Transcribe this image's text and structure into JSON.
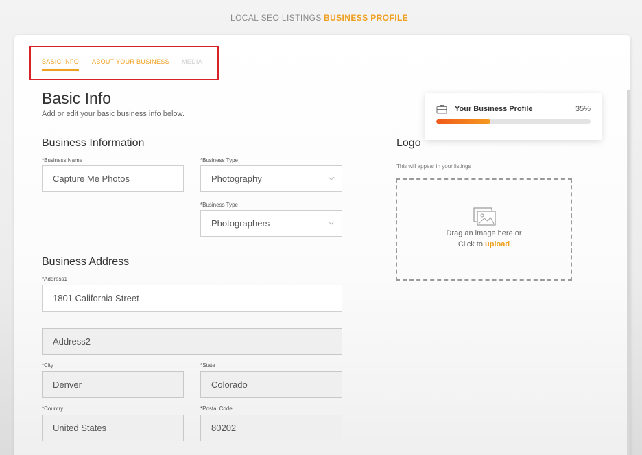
{
  "top_nav": {
    "local_seo": "LOCAL SEO LISTINGS",
    "business_profile": "BUSINESS PROFILE"
  },
  "sub_tabs": {
    "basic_info": "BASIC INFO",
    "about": "ABOUT YOUR BUSINESS",
    "media": "MEDIA"
  },
  "header": {
    "title": "Basic Info",
    "subtitle": "Add or edit your basic business info below."
  },
  "business_info": {
    "title": "Business Information",
    "name_label": "*Business Name",
    "name_value": "Capture Me Photos",
    "type_label": "*Business Type",
    "type_value": "Photography",
    "type2_label": "*Business Type",
    "type2_value": "Photographers"
  },
  "address": {
    "title": "Business Address",
    "address1_label": "*Address1",
    "address1_value": "1801 California Street",
    "address2_placeholder": "Address2",
    "city_label": "*City",
    "city_value": "Denver",
    "state_label": "*State",
    "state_value": "Colorado",
    "country_label": "*Country",
    "country_value": "United States",
    "postal_label": "*Postal Code",
    "postal_value": "80202"
  },
  "logo": {
    "title": "Logo",
    "hint": "This will appear in your listings",
    "drop_text": "Drag an image here or",
    "click_prefix": "Click to",
    "upload_link": "upload"
  },
  "profile_progress": {
    "title": "Your Business Profile",
    "percent_label": "35%",
    "percent": 35
  },
  "colors": {
    "accent": "#f0a020",
    "progress_start": "#f05a1a",
    "highlight_box": "#d8222a"
  },
  "icons": [
    "chevron-down-icon",
    "image-icon",
    "briefcase-icon"
  ]
}
